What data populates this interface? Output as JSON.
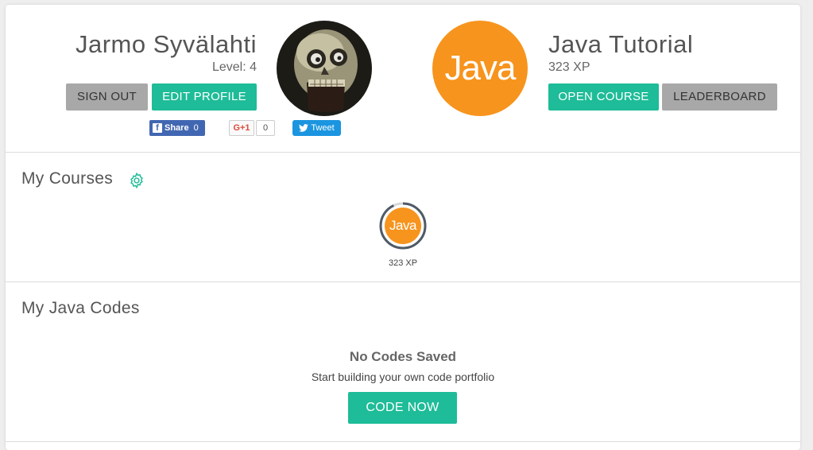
{
  "profile": {
    "user_name": "Jarmo Syvälahti",
    "level": "Level: 4",
    "sign_out": "SIGN OUT",
    "edit_profile": "EDIT PROFILE",
    "share": {
      "facebook_label": "Share",
      "facebook_count": "0",
      "gplus_label": "G+1",
      "gplus_count": "0",
      "tweet_label": "Tweet"
    }
  },
  "course": {
    "badge_text": "Java",
    "title": "Java Tutorial",
    "xp": "323 XP",
    "open_course": "OPEN COURSE",
    "leaderboard": "LEADERBOARD"
  },
  "my_courses": {
    "title": "My Courses",
    "items": [
      {
        "name": "Java",
        "xp": "323 XP",
        "progress": 0.93
      }
    ]
  },
  "my_codes": {
    "title": "My Java Codes",
    "empty_title": "No Codes Saved",
    "empty_subtitle": "Start building your own code portfolio",
    "code_now": "CODE NOW"
  },
  "colors": {
    "accent_green": "#1ebc98",
    "java_orange": "#f7941d",
    "gray_button": "#a8a8a8"
  }
}
